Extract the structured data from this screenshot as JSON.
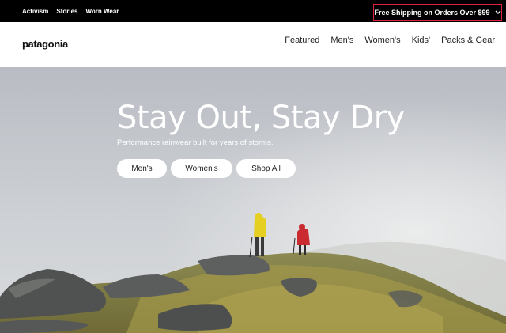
{
  "topbar": {
    "links": [
      "Activism",
      "Stories",
      "Worn Wear"
    ],
    "promo": "Free Shipping on Orders Over $99"
  },
  "header": {
    "logo": "patagonia",
    "nav": [
      "Featured",
      "Men's",
      "Women's",
      "Kids'",
      "Packs & Gear"
    ]
  },
  "hero": {
    "title": "Stay Out, Stay Dry",
    "subtitle": "Performance rainwear built for years of storms.",
    "buttons": [
      "Men's",
      "Women's",
      "Shop All"
    ]
  },
  "icons": {
    "promo_toggle": "chevron-down-icon"
  }
}
